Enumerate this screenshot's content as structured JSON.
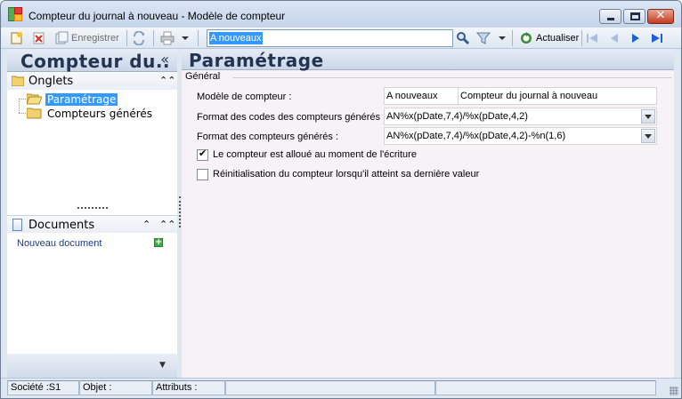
{
  "window": {
    "title": "Compteur du journal à nouveau -  Modèle de compteur"
  },
  "toolbar": {
    "save_label": "Enregistrer",
    "search_value": "A nouveaux",
    "refresh_label": "Actualiser"
  },
  "left_panel": {
    "title": "Compteur du..",
    "collapse_glyph": "«",
    "tabs_section": {
      "label": "Onglets",
      "items": [
        {
          "label": "Paramétrage",
          "selected": true
        },
        {
          "label": "Compteurs générés",
          "selected": false
        }
      ]
    },
    "documents_section": {
      "label": "Documents",
      "new_document_label": "Nouveau document"
    }
  },
  "main": {
    "title": "Paramétrage",
    "group_label": "Général",
    "fields": {
      "model_label": "Modèle de compteur :",
      "model_code": "A nouveaux",
      "model_name": "Compteur du journal à nouveau",
      "codes_format_label": "Format des codes des compteurs générés :",
      "codes_format_value": "AN%x(pDate,7,4)/%x(pDate,4,2)",
      "counters_format_label": "Format des compteurs générés :",
      "counters_format_value": "AN%x(pDate,7,4)/%x(pDate,4,2)-%n(1,6)"
    },
    "checkboxes": [
      {
        "label": "Le compteur est alloué au moment de l'écriture",
        "checked": true
      },
      {
        "label": "Réinitialisation du compteur lorsqu'il atteint sa dernière valeur",
        "checked": false
      }
    ]
  },
  "statusbar": {
    "company": "Société :S1",
    "object": "Objet :",
    "attributes": "Attributs :"
  },
  "colors": {
    "selection": "#3399ff",
    "header_text": "#22344f",
    "link": "#1a3a8a"
  }
}
